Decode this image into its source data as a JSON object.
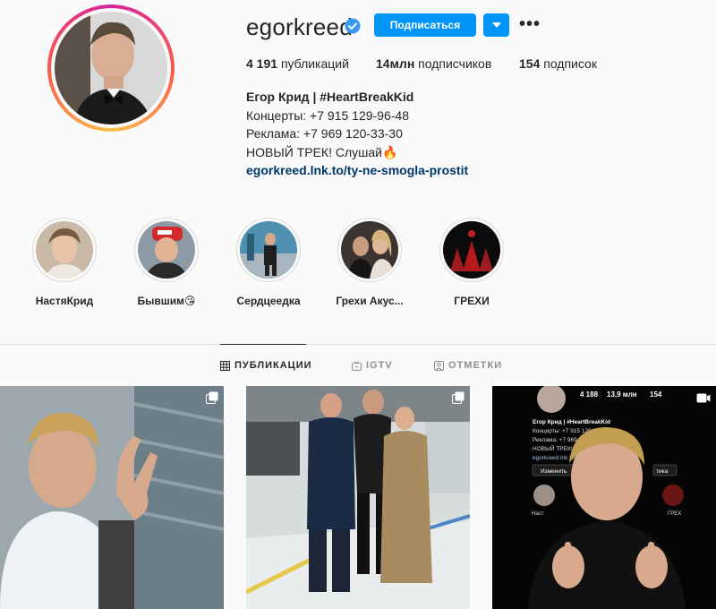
{
  "profile": {
    "username": "egorkreed",
    "follow_label": "Подписаться",
    "stats": {
      "posts_count": "4 191",
      "posts_label": "публикаций",
      "followers_count": "14млн",
      "followers_label": "подписчиков",
      "following_count": "154",
      "following_label": "подписок"
    },
    "bio": {
      "name": "Егор Крид | #HeartBreakKid",
      "line1": "Концерты: +7 915 129-96-48",
      "line2": "Реклама: +7 969 120-33-30",
      "line3": "НОВЫЙ ТРЕК! Слушай🔥",
      "link": "egorkreed.lnk.to/ty-ne-smogla-prostit"
    }
  },
  "highlights": [
    {
      "label": "НастяКрид"
    },
    {
      "label": "Бывшим😘"
    },
    {
      "label": "Сердцеедка"
    },
    {
      "label": "Грехи Акус..."
    },
    {
      "label": "ГРЕХИ"
    }
  ],
  "tabs": {
    "posts": "ПУБЛИКАЦИИ",
    "igtv": "IGTV",
    "tagged": "ОТМЕТКИ"
  },
  "embedded_screenshot": {
    "posts": "4 188",
    "followers": "13,9 млн",
    "following": "154",
    "name": "Егор Крид | #HeartBreakKid",
    "line1": "Концерты: +7 915 129-96-48",
    "line2": "Реклама: +7 969 120-33-30",
    "line3": "НОВЫЙ ТРЕК! Слушай 🔥",
    "link": "egorkreed.lnk.to/ty-ne-sm",
    "edit_button": "Изменить",
    "partial_button": "Пр",
    "partial_button2": "тика",
    "hl_label_left": "Наст",
    "hl_label_right": "ГРЕХ"
  },
  "colors": {
    "accent": "#0095f6",
    "link": "#00376b",
    "text": "#262626",
    "muted": "#8e8e8e",
    "border": "#dbdbdb",
    "background": "#fafafa"
  },
  "icons": {
    "verified": "verified-badge-icon",
    "dropdown": "chevron-down-icon",
    "more": "more-options-icon",
    "grid": "grid-icon",
    "igtv": "igtv-icon",
    "tagged": "tagged-icon",
    "multi": "carousel-icon",
    "video": "igtv-video-icon"
  }
}
